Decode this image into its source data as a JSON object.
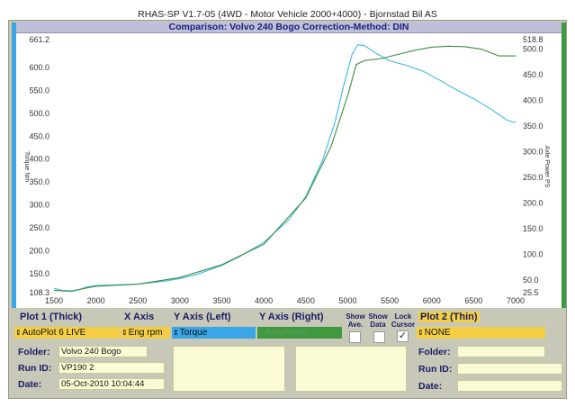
{
  "app": {
    "title": "RHAS-SP V1.7-05   (4WD - Motor Vehicle 2000+4000) - Bjornstad Bil AS"
  },
  "header": {
    "title": "Comparison: Volvo 240 Bogo    Correction-Method: DIN"
  },
  "chart_data": {
    "type": "line",
    "xlabel": "",
    "ylabel_left": "Torque Nm",
    "ylabel_right": "Axle Power PS",
    "xlim": [
      1500,
      7000
    ],
    "ylim_left": [
      108.3,
      661.2
    ],
    "ylim_right": [
      25.5,
      518.8
    ],
    "x_ticks": [
      "1500",
      "2000",
      "2500",
      "3000",
      "3500",
      "4000",
      "4500",
      "5000",
      "5500",
      "6000",
      "6500",
      "7000"
    ],
    "y_left_ticks": [
      {
        "v": 661.2,
        "label": "661.2"
      },
      {
        "v": 600,
        "label": "600.0"
      },
      {
        "v": 550,
        "label": "550.0"
      },
      {
        "v": 500,
        "label": "500.0"
      },
      {
        "v": 450,
        "label": "450.0"
      },
      {
        "v": 400,
        "label": "400.0"
      },
      {
        "v": 350,
        "label": "350.0"
      },
      {
        "v": 300,
        "label": "300.0"
      },
      {
        "v": 250,
        "label": "250.0"
      },
      {
        "v": 200,
        "label": "200.0"
      },
      {
        "v": 150,
        "label": "150.0"
      },
      {
        "v": 108.3,
        "label": "108.3"
      }
    ],
    "y_right_ticks": [
      {
        "v": 518.8,
        "label": "518.8"
      },
      {
        "v": 500,
        "label": "500.0"
      },
      {
        "v": 450,
        "label": "450.0"
      },
      {
        "v": 400,
        "label": "400.0"
      },
      {
        "v": 350,
        "label": "350.0"
      },
      {
        "v": 300,
        "label": "300.0"
      },
      {
        "v": 250,
        "label": "250.0"
      },
      {
        "v": 200,
        "label": "200.0"
      },
      {
        "v": 150,
        "label": "150.0"
      },
      {
        "v": 100,
        "label": "100.0"
      },
      {
        "v": 50,
        "label": "50.0"
      },
      {
        "v": 25.5,
        "label": "25.5"
      }
    ],
    "series": [
      {
        "name": "Torque",
        "axis": "left",
        "color": "#3ab8e0",
        "x": [
          1500,
          1600,
          1700,
          1800,
          1900,
          2000,
          2200,
          2500,
          2800,
          3000,
          3200,
          3500,
          3700,
          4000,
          4300,
          4500,
          4700,
          4850,
          4950,
          5050,
          5120,
          5200,
          5350,
          5500,
          5700,
          5900,
          6100,
          6300,
          6500,
          6700,
          6900,
          7000
        ],
        "y": [
          118,
          113,
          112,
          115,
          121,
          124,
          125,
          127,
          133,
          139,
          148,
          168,
          186,
          218,
          268,
          318,
          398,
          482,
          560,
          628,
          650,
          648,
          630,
          615,
          605,
          592,
          572,
          551,
          532,
          510,
          485,
          480
        ]
      },
      {
        "name": "AxlePower",
        "axis": "right",
        "color": "#3c8c3c",
        "x": [
          1500,
          1700,
          1900,
          2000,
          2500,
          3000,
          3500,
          4000,
          4500,
          4800,
          5000,
          5100,
          5200,
          5400,
          5600,
          5800,
          6000,
          6200,
          6400,
          6600,
          6800,
          7000
        ],
        "y": [
          30,
          28,
          35,
          38,
          42,
          55,
          80,
          120,
          210,
          310,
          410,
          470,
          478,
          482,
          490,
          498,
          504,
          506,
          505,
          500,
          487,
          487
        ]
      }
    ]
  },
  "controls": {
    "plot1_label": "Plot 1 (Thick)",
    "x_axis_label": "X Axis",
    "y_left_label": "Y Axis (Left)",
    "y_right_label": "Y Axis (Right)",
    "show_ave_label_1": "Show",
    "show_ave_label_2": "Ave.",
    "show_data_label_1": "Show",
    "show_data_label_2": "Data",
    "lock_cursor_label_1": "Lock",
    "lock_cursor_label_2": "Cursor",
    "plot2_label": "Plot 2 (Thin)",
    "plot1_value": "AutoPlot 6 LIVE",
    "x_axis_value": "Eng rpm",
    "y_left_value": "Torque",
    "y_right_value": "AxlePower",
    "plot2_value": "NONE",
    "show_ave_checked": false,
    "show_data_checked": false,
    "lock_cursor_checked": true,
    "check_glyph": "✓",
    "arrow_glyph": "⇕",
    "colors": {
      "plot1": "#f4cf45",
      "x_axis": "#f4cf45",
      "y_left": "#3aa6e8",
      "y_right": "#3f9a3f",
      "plot2": "#f4cf45"
    }
  },
  "info_left": {
    "folder_label": "Folder:",
    "folder_value": "Volvo 240 Bogo",
    "runid_label": "Run ID:",
    "runid_value": "VP190  2",
    "date_label": "Date:",
    "date_value": "05-Oct-2010  10:04:44"
  },
  "info_right": {
    "folder_label": "Folder:",
    "runid_label": "Run ID:",
    "date_label": "Date:"
  }
}
